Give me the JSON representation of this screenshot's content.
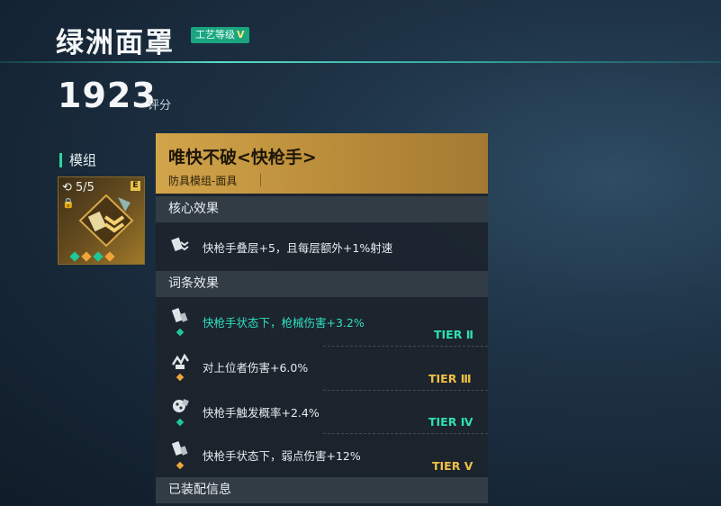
{
  "item": {
    "title": "绿洲面罩",
    "craft_badge_label": "工艺等级",
    "craft_badge_level": "V",
    "score_value": "1923",
    "score_label": "评分"
  },
  "module_section": {
    "header": "模组",
    "count": "5/5",
    "grade": "E"
  },
  "panel": {
    "name": "唯快不破<快枪手>",
    "subtitle": "防具模组-面具",
    "core_header": "核心效果",
    "core_effect": "快枪手叠层+5，且每层额外+1%射速",
    "affix_header": "词条效果",
    "affixes": [
      {
        "text": "快枪手状态下，枪械伤害+3.2%",
        "tier": "TIER Ⅱ",
        "highlight": true,
        "gem": "teal"
      },
      {
        "text": "对上位者伤害+6.0%",
        "tier": "TIER Ⅲ",
        "highlight": false,
        "gem": "orange"
      },
      {
        "text": "快枪手触发概率+2.4%",
        "tier": "TIER Ⅳ",
        "highlight": false,
        "gem": "teal"
      },
      {
        "text": "快枪手状态下，弱点伤害+12%",
        "tier": "TIER Ⅴ",
        "highlight": false,
        "gem": "orange"
      }
    ],
    "equipped_header": "已装配信息"
  },
  "colors": {
    "accent_teal": "#2fe0b0",
    "accent_gold": "#f0c043",
    "header_gold": "#d2a44a"
  }
}
